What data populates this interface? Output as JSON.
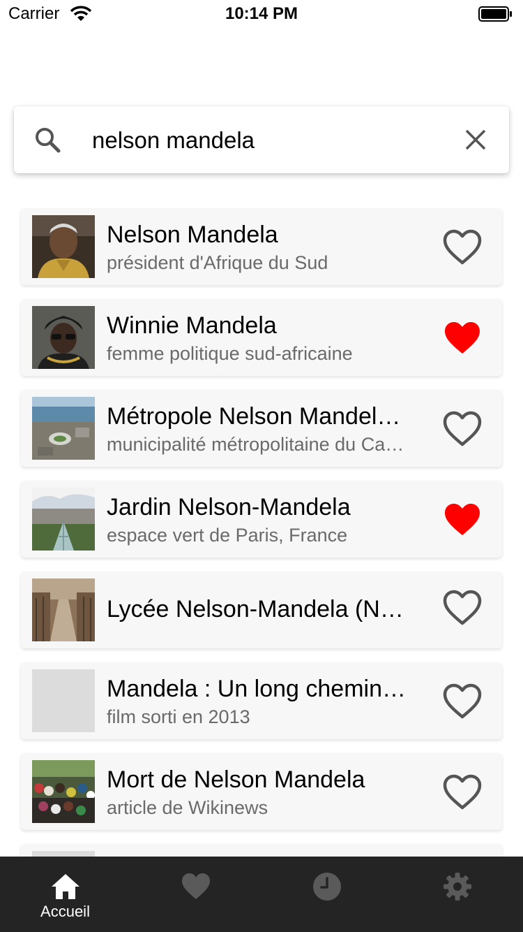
{
  "status_bar": {
    "carrier": "Carrier",
    "time": "10:14 PM"
  },
  "search": {
    "query": "nelson mandela"
  },
  "results": [
    {
      "title": "Nelson Mandela",
      "subtitle": "président d'Afrique du Sud",
      "favorite": false,
      "thumbnail": "portrait-photo"
    },
    {
      "title": "Winnie Mandela",
      "subtitle": "femme politique sud-africaine",
      "favorite": true,
      "thumbnail": "portrait-photo"
    },
    {
      "title": "Métropole Nelson Mandel…",
      "subtitle": "municipalité métropolitaine du Ca…",
      "favorite": false,
      "thumbnail": "aerial-city-photo"
    },
    {
      "title": "Jardin Nelson-Mandela",
      "subtitle": "espace vert de Paris, France",
      "favorite": true,
      "thumbnail": "garden-photo"
    },
    {
      "title": "Lycée Nelson-Mandela (N…",
      "subtitle": "",
      "favorite": false,
      "thumbnail": "school-hall-photo"
    },
    {
      "title": "Mandela : Un long chemin…",
      "subtitle": "film sorti en 2013",
      "favorite": false,
      "thumbnail": "placeholder"
    },
    {
      "title": "Mort de Nelson Mandela",
      "subtitle": "article de Wikinews",
      "favorite": false,
      "thumbnail": "crowd-photo"
    }
  ],
  "tab_bar": {
    "tabs": [
      {
        "icon": "home-icon",
        "label": "Accueil",
        "active": true
      },
      {
        "icon": "heart-icon",
        "label": "",
        "active": false
      },
      {
        "icon": "clock-icon",
        "label": "",
        "active": false
      },
      {
        "icon": "gear-icon",
        "label": "",
        "active": false
      }
    ]
  },
  "colors": {
    "favorite_active": "#ff0000",
    "favorite_inactive": "#555555",
    "tab_bar_bg": "#242424",
    "tab_active": "#ffffff",
    "tab_inactive": "#5a5a5a",
    "card_bg": "#f7f7f7",
    "subtitle_text": "#6a6a6a"
  }
}
